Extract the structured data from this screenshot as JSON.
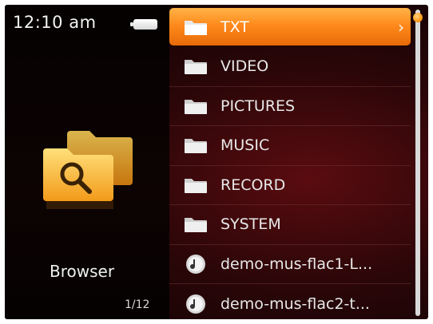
{
  "status": {
    "time": "12:10 am",
    "battery_icon": "battery-full-icon"
  },
  "app": {
    "label": "Browser",
    "icon": "folder-search-icon",
    "page_counter": "1/12"
  },
  "list": {
    "selected_index": 0,
    "items": [
      {
        "label": "TXT",
        "type": "folder",
        "icon": "folder-icon"
      },
      {
        "label": "VIDEO",
        "type": "folder",
        "icon": "folder-icon"
      },
      {
        "label": "PICTURES",
        "type": "folder",
        "icon": "folder-icon"
      },
      {
        "label": "MUSIC",
        "type": "folder",
        "icon": "folder-icon"
      },
      {
        "label": "RECORD",
        "type": "folder",
        "icon": "folder-icon"
      },
      {
        "label": "SYSTEM",
        "type": "folder",
        "icon": "folder-icon"
      },
      {
        "label": "demo-mus-flac1-L...",
        "type": "file",
        "icon": "music-disc-icon"
      },
      {
        "label": "demo-mus-flac2-t...",
        "type": "file",
        "icon": "music-disc-icon"
      }
    ],
    "chevron": "›"
  },
  "colors": {
    "accent": "#ff8a1c",
    "background": "#2a0608",
    "text": "#e8e8e8"
  }
}
